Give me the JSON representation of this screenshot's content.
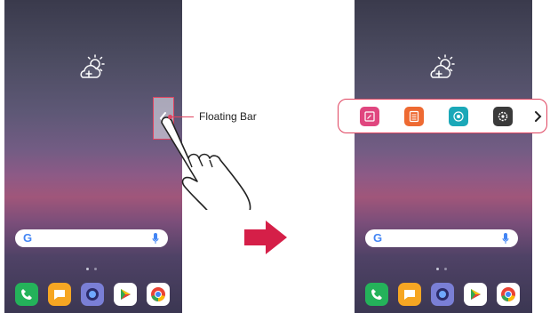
{
  "callout": {
    "label": "Floating Bar"
  },
  "colors": {
    "accent": "#e04460",
    "arrow": "#d51f48"
  },
  "left_screen": {
    "weather_icon": "partly-cloudy-icon",
    "search": {
      "logo": "G",
      "mic_icon": "mic-icon"
    },
    "floating_tab_icon": "chevron-left-icon",
    "dock": [
      "phone-icon",
      "messages-icon",
      "camera-icon",
      "play-store-icon",
      "chrome-icon"
    ]
  },
  "right_screen": {
    "weather_icon": "partly-cloudy-icon",
    "search": {
      "logo": "G",
      "mic_icon": "mic-icon"
    },
    "floating_bar": {
      "items": [
        "quick-memo-icon",
        "notes-icon",
        "camera-shortcut-icon",
        "settings-shortcut-icon"
      ],
      "more_icon": "chevron-right-icon"
    },
    "dock": [
      "phone-icon",
      "messages-icon",
      "camera-icon",
      "play-store-icon",
      "chrome-icon"
    ]
  },
  "transition_arrow": "arrow-right-icon"
}
